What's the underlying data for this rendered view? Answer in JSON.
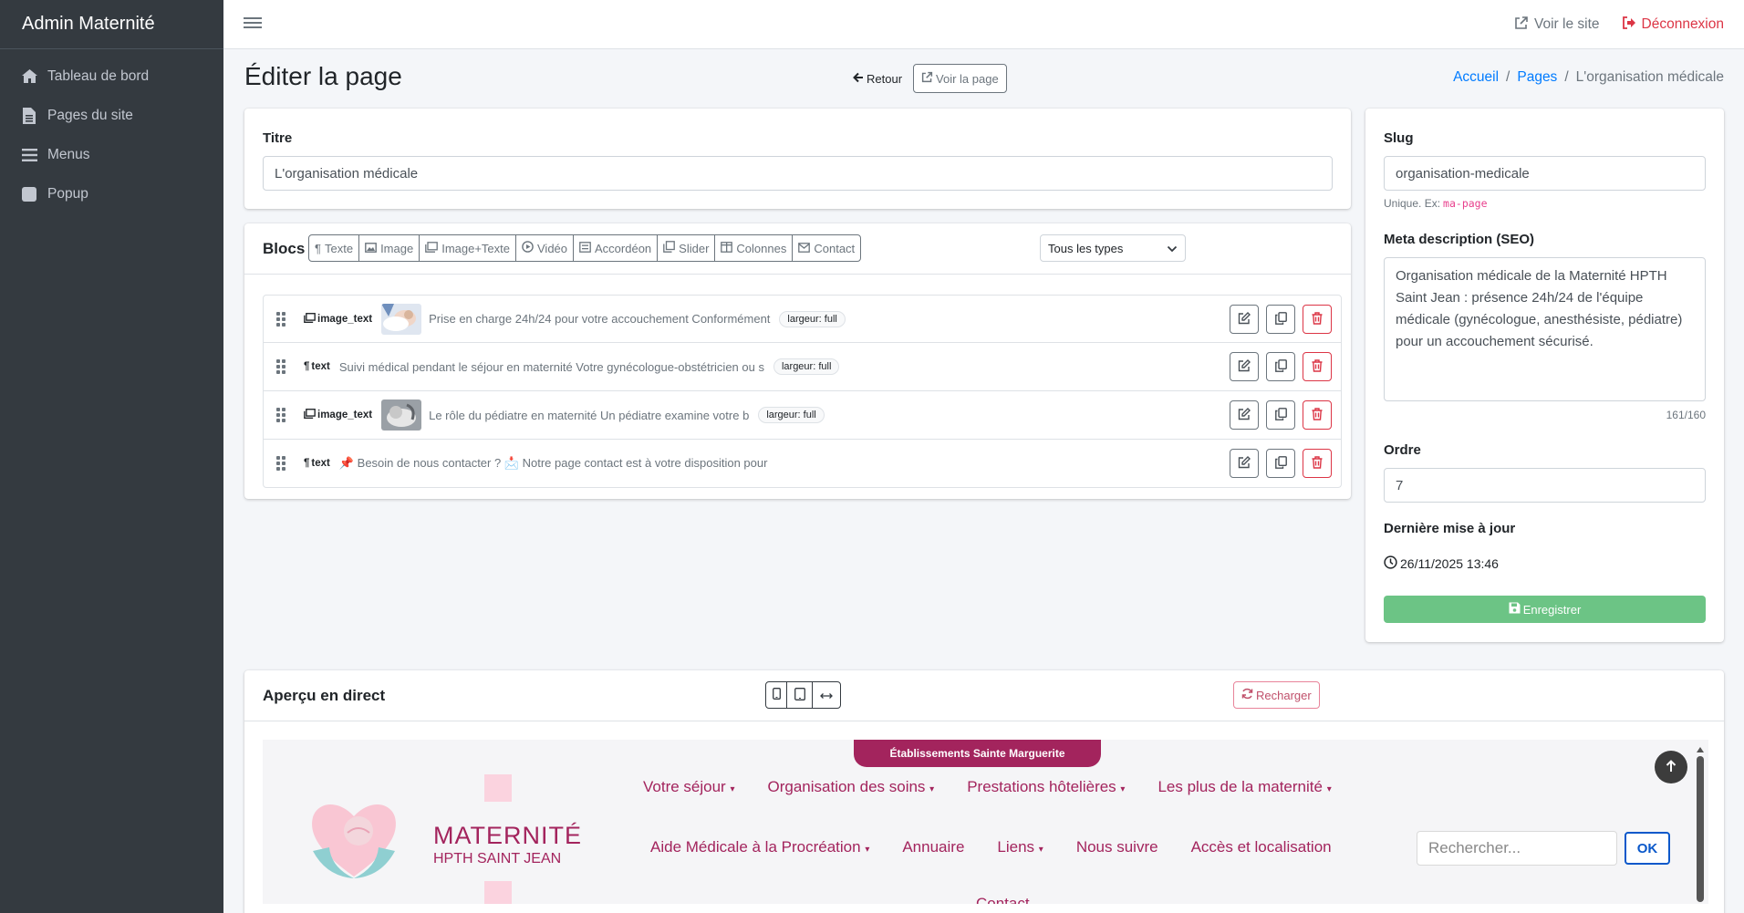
{
  "sidebar": {
    "brand": "Admin Maternité",
    "items": [
      {
        "label": "Tableau de bord"
      },
      {
        "label": "Pages du site"
      },
      {
        "label": "Menus"
      },
      {
        "label": "Popup"
      }
    ]
  },
  "topbar": {
    "view_site": "Voir le site",
    "logout": "Déconnexion"
  },
  "header": {
    "title": "Éditer la page",
    "back": "Retour",
    "view_page": "Voir la page",
    "breadcrumb": [
      "Accueil",
      "Pages",
      "L'organisation médicale"
    ]
  },
  "form": {
    "title_label": "Titre",
    "title_value": "L'organisation médicale",
    "slug_label": "Slug",
    "slug_value": "organisation-medicale",
    "slug_help": "Unique. Ex:",
    "slug_example": "ma-page",
    "meta_label": "Meta description (SEO)",
    "meta_value": "Organisation médicale de la Maternité HPTH Saint Jean : présence 24h/24 de l'équipe médicale (gynécologue, anesthésiste, pédiatre) pour un accouchement sécurisé.",
    "meta_count": "161/160",
    "order_label": "Ordre",
    "order_value": "7",
    "updated_label": "Dernière mise à jour",
    "updated_value": "26/11/2025 13:46",
    "save": "Enregistrer"
  },
  "blocks": {
    "title": "Blocs",
    "add_buttons": [
      "Texte",
      "Image",
      "Image+Texte",
      "Vidéo",
      "Accordéon",
      "Slider",
      "Colonnes",
      "Contact"
    ],
    "filter": "Tous les types",
    "items": [
      {
        "type": "image_text",
        "summary": "Prise en charge 24h/24 pour votre accouchement Conformément",
        "badge": "largeur: full"
      },
      {
        "type": "text",
        "summary": "Suivi médical pendant le séjour en maternité Votre gynécologue-obstétricien ou s",
        "badge": "largeur: full"
      },
      {
        "type": "image_text",
        "summary": "Le rôle du pédiatre en maternité Un pédiatre examine votre b",
        "badge": "largeur: full"
      },
      {
        "type": "text",
        "summary": "📌 Besoin de nous contacter ? 📩 Notre page contact est à votre disposition pour",
        "badge": ""
      }
    ]
  },
  "preview": {
    "title": "Aperçu en direct",
    "reload": "Recharger",
    "site": {
      "ribbon": "Établissements Sainte Marguerite",
      "logo_line1": "MATERNITÉ",
      "logo_line2": "HPTH SAINT JEAN",
      "nav_row1": [
        "Votre séjour",
        "Organisation des soins",
        "Prestations hôtelières",
        "Les plus de la maternité"
      ],
      "nav_row2": [
        "Aide Médicale à la Procréation",
        "Annuaire",
        "Liens",
        "Nous suivre",
        "Accès et localisation"
      ],
      "nav_row3": [
        "Contact"
      ],
      "search_placeholder": "Rechercher...",
      "search_btn": "OK"
    }
  },
  "colors": {
    "sidebar_bg": "#343a40",
    "primary": "#007bff",
    "danger": "#dc3545",
    "success": "#6cc485",
    "brand_pink": "#a3245d"
  }
}
